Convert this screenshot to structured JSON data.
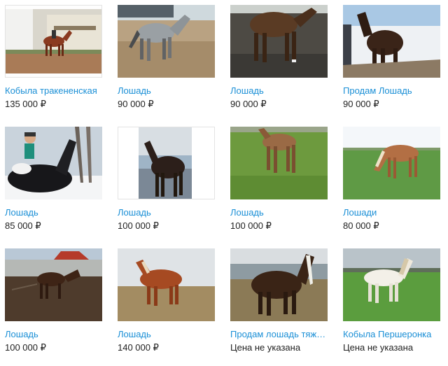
{
  "listings": [
    {
      "title": "Кобыла тракененская",
      "price": "135 000 ₽",
      "photo_icon": "horse-photo-icon"
    },
    {
      "title": "Лошадь",
      "price": "90 000 ₽",
      "photo_icon": "horse-photo-icon"
    },
    {
      "title": "Лошадь",
      "price": "90 000 ₽",
      "photo_icon": "horse-photo-icon"
    },
    {
      "title": "Продам Лошадь",
      "price": "90 000 ₽",
      "photo_icon": "horse-photo-icon"
    },
    {
      "title": "Лошадь",
      "price": "85 000 ₽",
      "photo_icon": "horse-photo-icon"
    },
    {
      "title": "Лошадь",
      "price": "100 000 ₽",
      "photo_icon": "horse-photo-icon"
    },
    {
      "title": "Лошадь",
      "price": "100 000 ₽",
      "photo_icon": "horse-photo-icon"
    },
    {
      "title": "Лошади",
      "price": "80 000 ₽",
      "photo_icon": "horse-photo-icon"
    },
    {
      "title": "Лошадь",
      "price": "100 000 ₽",
      "photo_icon": "horse-photo-icon"
    },
    {
      "title": "Лошадь",
      "price": "140 000 ₽",
      "photo_icon": "horse-photo-icon"
    },
    {
      "title": "Продам лошадь тяжеловоза",
      "price": "Цена не указана",
      "photo_icon": "horse-photo-icon"
    },
    {
      "title": "Кобыла Першеронка",
      "price": "Цена не указана",
      "photo_icon": "horse-photo-icon"
    }
  ],
  "colors": {
    "title_link": "#1a8fd6",
    "price_text": "#222222"
  }
}
